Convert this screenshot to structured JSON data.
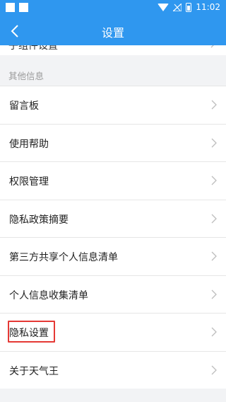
{
  "status_bar": {
    "time": "11:02",
    "icons": [
      "square-icon",
      "square-icon",
      "wifi-icon",
      "signal-icon",
      "battery-icon"
    ]
  },
  "app_bar": {
    "title": "设置",
    "back_icon": "chevron-left-icon"
  },
  "partial_row": {
    "label": "子组件设置"
  },
  "section": {
    "header": "其他信息",
    "items": [
      {
        "label": "留言板"
      },
      {
        "label": "使用帮助"
      },
      {
        "label": "权限管理"
      },
      {
        "label": "隐私政策摘要"
      },
      {
        "label": "第三方共享个人信息清单"
      },
      {
        "label": "个人信息收集清单"
      },
      {
        "label": "隐私设置"
      },
      {
        "label": "关于天气王"
      }
    ]
  },
  "colors": {
    "primary": "#2f97ef",
    "background": "#f2f3f5",
    "highlight": "#e53935"
  }
}
